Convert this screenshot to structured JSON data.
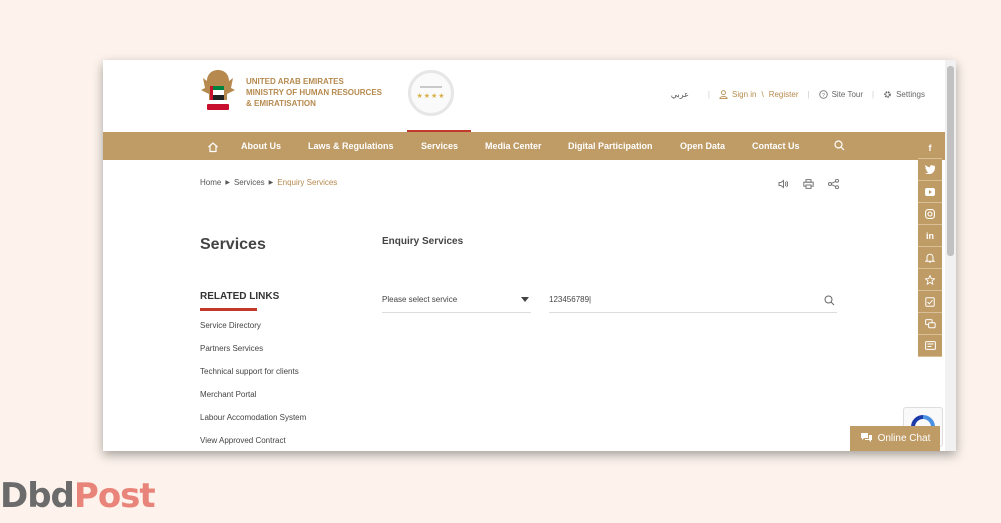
{
  "header": {
    "org_line1": "UNITED ARAB EMIRATES",
    "org_line2": "MINISTRY OF HUMAN RESOURCES",
    "org_line3": "& EMIRATISATION",
    "arabic_link": "عربي",
    "sign_in": "Sign in",
    "link_separator": "\\",
    "register": "Register",
    "site_tour": "Site Tour",
    "settings": "Settings"
  },
  "nav": {
    "items": [
      "About Us",
      "Laws & Regulations",
      "Services",
      "Media Center",
      "Digital Participation",
      "Open Data",
      "Contact Us"
    ],
    "active": "Services"
  },
  "breadcrumb": {
    "items": [
      "Home",
      "Services",
      "Enquiry Services"
    ]
  },
  "page": {
    "title": "Services",
    "related_title": "RELATED LINKS",
    "related_links": [
      "Service Directory",
      "Partners Services",
      "Technical support for clients",
      "Merchant Portal",
      "Labour Accomodation System",
      "View Approved Contract"
    ],
    "section_title": "Enquiry Services",
    "select_value": "Please select service",
    "search_value": "123456789|"
  },
  "social": {
    "items": [
      "facebook-icon",
      "twitter-icon",
      "youtube-icon",
      "instagram-icon",
      "linkedin-icon",
      "notification-icon",
      "star-icon",
      "checklist-icon",
      "chat-bubbles-icon",
      "feedback-icon"
    ],
    "linkedin_text": "in",
    "facebook_text": "f"
  },
  "chat": {
    "label": "Online Chat"
  },
  "watermark": {
    "part1": "Dbd",
    "part2": "Post"
  },
  "colors": {
    "gold": "#bf9b66",
    "accent_red": "#c0392b",
    "text_gold": "#b68a4e"
  }
}
